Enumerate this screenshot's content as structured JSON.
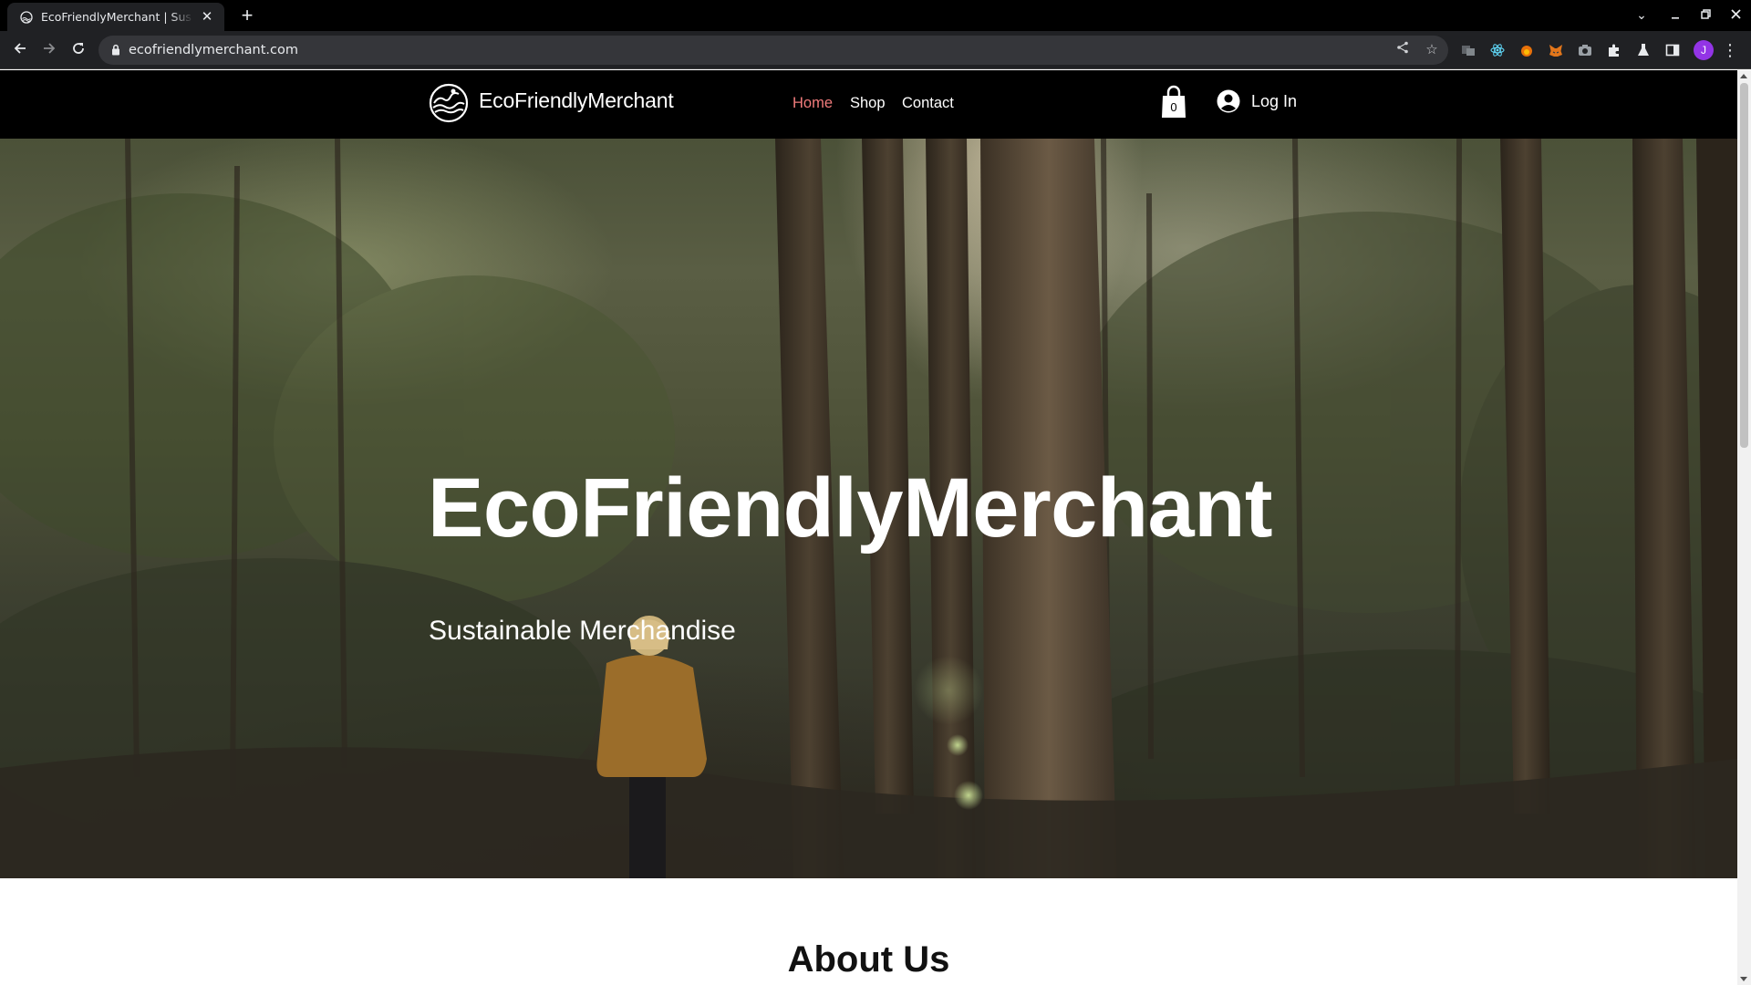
{
  "browser": {
    "tab_title": "EcoFriendlyMerchant | Sus",
    "tab_close": "✕",
    "new_tab": "+",
    "url": "ecofriendlymerchant.com",
    "profile_initial": "J",
    "extensions": [
      "extension-icon",
      "react-devtools-icon",
      "fire-extension-icon",
      "metamask-fox-icon",
      "camera-extension-icon",
      "puzzle-extensions-icon",
      "flask-labs-icon",
      "side-panel-icon"
    ]
  },
  "site": {
    "logo_text": "EcoFriendlyMerchant",
    "nav": {
      "home": "Home",
      "shop": "Shop",
      "contact": "Contact"
    },
    "nav_active_color": "#f27c7c",
    "cart_count": "0",
    "login_label": "Log In"
  },
  "hero": {
    "title": "EcoFriendlyMerchant",
    "subtitle": "Sustainable Merchandise"
  },
  "about": {
    "title": "About Us"
  }
}
